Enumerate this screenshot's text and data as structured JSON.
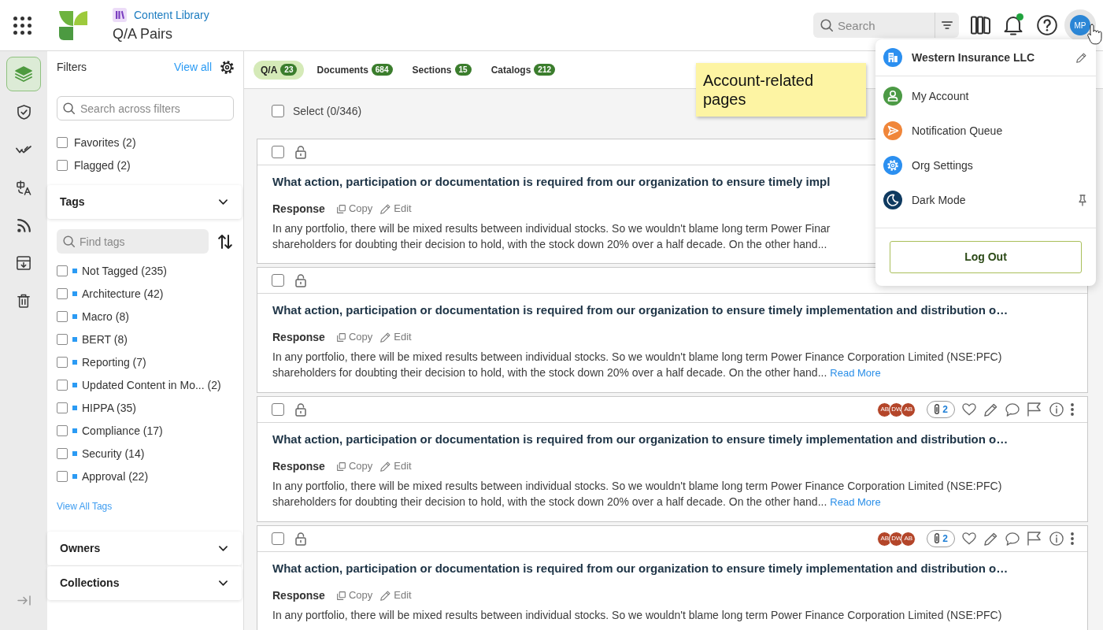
{
  "header": {
    "breadcrumb": "Content Library",
    "title": "Q/A Pairs",
    "search": {
      "placeholder": "Search"
    },
    "notification_dot": true,
    "avatar": "MP"
  },
  "rail": [
    {
      "selected": true
    },
    {
      "selected": false
    },
    {
      "selected": false
    },
    {
      "selected": false
    },
    {
      "selected": false
    },
    {
      "selected": false
    },
    {
      "selected": false
    }
  ],
  "filters": {
    "title": "Filters",
    "view_all": "View all",
    "search": {
      "placeholder": "Search across filters"
    },
    "options": [
      {
        "label": "Favorites (2)",
        "checked": false
      },
      {
        "label": "Flagged (2)",
        "checked": false
      }
    ]
  },
  "tags": {
    "title": "Tags",
    "search": {
      "placeholder": "Find tags"
    },
    "items": [
      {
        "label": "Not Tagged (235)",
        "checked": false
      },
      {
        "label": "Architecture (42)",
        "checked": false
      },
      {
        "label": "Macro (8)",
        "checked": false
      },
      {
        "label": "BERT (8)",
        "checked": false
      },
      {
        "label": "Reporting (7)",
        "checked": false
      },
      {
        "label": "Updated Content in Mo... (2)",
        "checked": false
      },
      {
        "label": "HIPPA (35)",
        "checked": false
      },
      {
        "label": "Compliance (17)",
        "checked": false
      },
      {
        "label": "Security (14)",
        "checked": false
      },
      {
        "label": "Approval (22)",
        "checked": false
      }
    ],
    "view_all": "View All Tags"
  },
  "sections": [
    {
      "title": "Owners"
    },
    {
      "title": "Collections"
    }
  ],
  "tabs": [
    {
      "label": "Q/A",
      "count": "23",
      "selected": true
    },
    {
      "label": "Documents",
      "count": "684",
      "selected": false
    },
    {
      "label": "Sections",
      "count": "15",
      "selected": false
    },
    {
      "label": "Catalogs",
      "count": "212",
      "selected": false
    }
  ],
  "select_all": {
    "label": "Select (0/346)",
    "checked": false
  },
  "cards": [
    {
      "checked": false,
      "title": "What action, participation or documentation is required from our organization to ensure timely impl",
      "response_label": "Response",
      "copy": "Copy",
      "edit": "Edit",
      "body": "In any portfolio, there will be mixed results between individual stocks. So we wouldn't blame long term Power Finar\nshareholders for doubting their decision to hold, with the stock down 20% over a half decade. On the other hand..."
    },
    {
      "checked": false,
      "title": "What action, participation or documentation is required from our organization to ensure timely implementation and distribution o…",
      "response_label": "Response",
      "copy": "Copy",
      "edit": "Edit",
      "body": "In any portfolio, there will be mixed results between individual stocks. So we wouldn't blame long term Power Finance Corporation Limited (NSE:PFC)\nshareholders for doubting their decision to hold, with the stock down 20% over a half decade. On the other hand...",
      "read_more": "Read More"
    },
    {
      "checked": false,
      "avatars": [
        "AB",
        "DW",
        "AB"
      ],
      "attachments": "2",
      "title": "What action, participation or documentation is required from our organization to ensure timely implementation and distribution o…",
      "response_label": "Response",
      "copy": "Copy",
      "edit": "Edit",
      "body": "In any portfolio, there will be mixed results between individual stocks. So we wouldn't blame long term Power Finance Corporation Limited (NSE:PFC)\nshareholders for doubting their decision to hold, with the stock down 20% over a half decade. On the other hand...",
      "read_more": "Read More"
    },
    {
      "checked": false,
      "avatars": [
        "AB",
        "DW",
        "AB"
      ],
      "attachments": "2",
      "title": "What action, participation or documentation is required from our organization to ensure timely implementation and distribution o…",
      "response_label": "Response",
      "copy": "Copy",
      "edit": "Edit",
      "body": "In any portfolio, there will be mixed results between individual stocks. So we wouldn't blame long term Power Finance Corporation Limited (NSE:PFC)"
    }
  ],
  "note": {
    "text": "Account-related pages"
  },
  "account_menu": {
    "org": "Western Insurance LLC",
    "items": [
      {
        "label": "My Account"
      },
      {
        "label": "Notification Queue"
      },
      {
        "label": "Org Settings"
      },
      {
        "label": "Dark Mode"
      }
    ],
    "logout": "Log Out"
  }
}
